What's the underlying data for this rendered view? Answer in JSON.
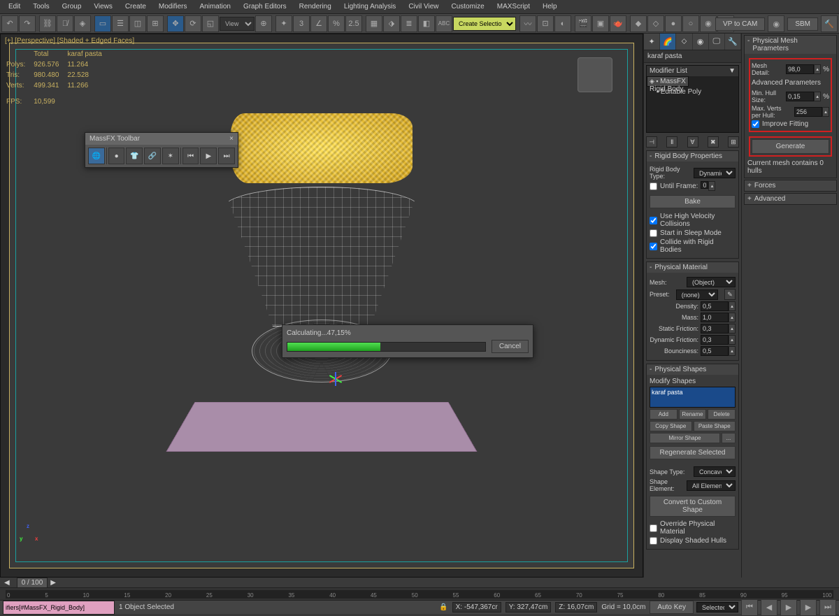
{
  "menu": [
    "Edit",
    "Tools",
    "Group",
    "Views",
    "Create",
    "Modifiers",
    "Animation",
    "Graph Editors",
    "Rendering",
    "Lighting Analysis",
    "Civil View",
    "Customize",
    "MAXScript",
    "Help"
  ],
  "topright": {
    "vp_btn": "VP to CAM",
    "sbm_btn": "SBM"
  },
  "toolbar": {
    "view_sel": "View",
    "create_sel": "Create Selection Se"
  },
  "viewport": {
    "label": "[+] [Perspective] [Shaded + Edged Faces]",
    "stats_hdr": [
      "",
      "Total",
      "karaf pasta"
    ],
    "stats": [
      [
        "Polys:",
        "926.576",
        "11.264"
      ],
      [
        "Tris:",
        "980.480",
        "22.528"
      ],
      [
        "Verts:",
        "499.341",
        "11.266"
      ]
    ],
    "fps_lbl": "FPS:",
    "fps_val": "10,599"
  },
  "massfx": {
    "title": "MassFX Toolbar",
    "close": "×"
  },
  "progress": {
    "label": "Calculating...47,15%",
    "cancel": "Cancel"
  },
  "cmd": {
    "obj": "karaf pasta",
    "modlist_lbl": "Modifier List",
    "mods": [
      "MassFX Rigid Body",
      "Editable Poly"
    ],
    "rollouts": {
      "rbp": {
        "title": "Rigid Body Properties",
        "type_lbl": "Rigid Body Type:",
        "type": "Dynamic",
        "until_lbl": "Until Frame:",
        "until": "0",
        "bake": "Bake",
        "hv": "Use High Velocity Collisions",
        "sleep": "Start in Sleep Mode",
        "collide": "Collide with Rigid Bodies"
      },
      "pm": {
        "title": "Physical Material",
        "mesh_lbl": "Mesh:",
        "mesh": "(Object)",
        "preset_lbl": "Preset:",
        "preset": "(none)",
        "density_lbl": "Density:",
        "density": "0,5",
        "mass_lbl": "Mass:",
        "mass": "1,0",
        "sf_lbl": "Static Friction:",
        "sf": "0,3",
        "df_lbl": "Dynamic Friction:",
        "df": "0,3",
        "b_lbl": "Bounciness:",
        "b": "0,5"
      },
      "ps": {
        "title": "Physical Shapes",
        "modify": "Modify Shapes",
        "item": "karaf pasta",
        "add": "Add",
        "rename": "Rename",
        "delete": "Delete",
        "copy": "Copy Shape",
        "paste": "Paste Shape",
        "mirror": "Mirror Shape",
        "dots": "...",
        "regen": "Regenerate Selected",
        "st_lbl": "Shape Type:",
        "st": "Concave",
        "se_lbl": "Shape Element:",
        "se": "All Elements",
        "convert": "Convert to Custom Shape",
        "override": "Override Physical Material",
        "display": "Display Shaded Hulls"
      }
    }
  },
  "params": {
    "pmp": {
      "title": "Physical Mesh Parameters",
      "md_lbl": "Mesh Detail:",
      "md": "98,0",
      "pct": "%",
      "adv": "Advanced Parameters",
      "mhs_lbl": "Min. Hull Size:",
      "mhs": "0,15",
      "mvph_lbl": "Max. Verts\nper Hull:",
      "mvph": "256",
      "fit": "Improve Fitting",
      "gen": "Generate",
      "status": "Current mesh contains 0 hulls"
    },
    "forces": "Forces",
    "advanced": "Advanced"
  },
  "timeline": {
    "frame": "0 / 100",
    "ticks": [
      "0",
      "5",
      "10",
      "15",
      "20",
      "25",
      "30",
      "35",
      "40",
      "45",
      "50",
      "55",
      "60",
      "65",
      "70",
      "75",
      "80",
      "85",
      "90",
      "95",
      "100"
    ]
  },
  "status": {
    "script": "ifiers[#MassFX_Rigid_Body]",
    "sel": "1 Object Selected",
    "x": "X: -547,367cr",
    "y": "Y: 327,47cm",
    "z": "Z: 16,07cm",
    "grid": "Grid = 10,0cm",
    "autokey": "Auto Key",
    "selected": "Selected"
  }
}
